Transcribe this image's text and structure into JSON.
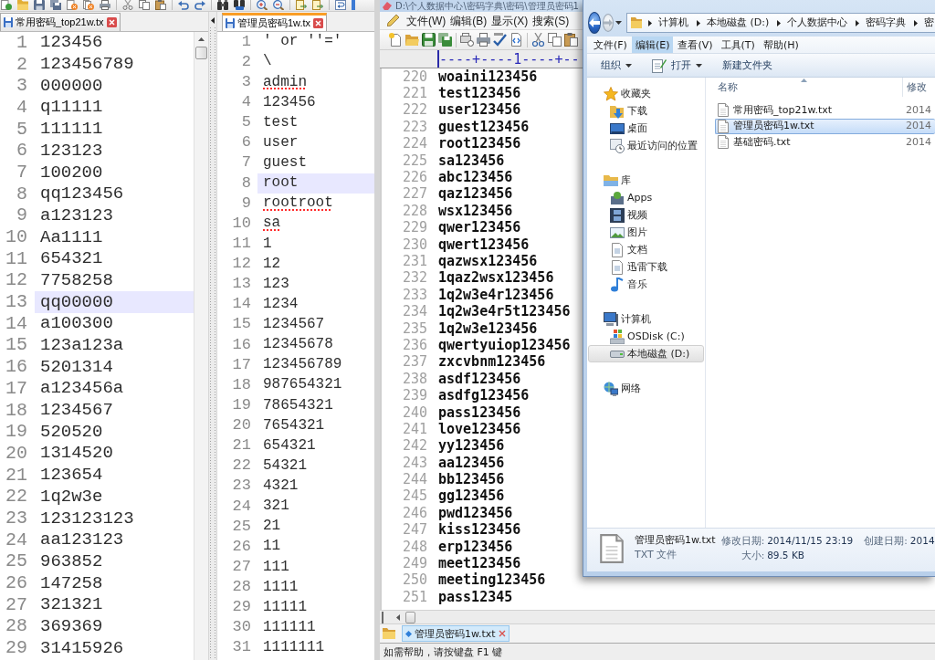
{
  "notepad": {
    "views": [
      {
        "tab": {
          "label": "常用密码_top21w.tx",
          "focused": false
        },
        "lines": [
          {
            "number": "1",
            "text": "123456",
            "current": false,
            "misspelled": false
          },
          {
            "number": "2",
            "text": "123456789",
            "current": false,
            "misspelled": false
          },
          {
            "number": "3",
            "text": "000000",
            "current": false,
            "misspelled": false
          },
          {
            "number": "4",
            "text": "q11111",
            "current": false,
            "misspelled": false
          },
          {
            "number": "5",
            "text": "111111",
            "current": false,
            "misspelled": false
          },
          {
            "number": "6",
            "text": "123123",
            "current": false,
            "misspelled": false
          },
          {
            "number": "7",
            "text": "100200",
            "current": false,
            "misspelled": false
          },
          {
            "number": "8",
            "text": "qq123456",
            "current": false,
            "misspelled": false
          },
          {
            "number": "9",
            "text": "a123123",
            "current": false,
            "misspelled": false
          },
          {
            "number": "10",
            "text": "Aa1111",
            "current": false,
            "misspelled": false
          },
          {
            "number": "11",
            "text": "654321",
            "current": false,
            "misspelled": false
          },
          {
            "number": "12",
            "text": "7758258",
            "current": false,
            "misspelled": false
          },
          {
            "number": "13",
            "text": "qq00000",
            "current": true,
            "misspelled": false
          },
          {
            "number": "14",
            "text": "a100300",
            "current": false,
            "misspelled": false
          },
          {
            "number": "15",
            "text": "123a123a",
            "current": false,
            "misspelled": false
          },
          {
            "number": "16",
            "text": "5201314",
            "current": false,
            "misspelled": false
          },
          {
            "number": "17",
            "text": "a123456a",
            "current": false,
            "misspelled": false
          },
          {
            "number": "18",
            "text": "1234567",
            "current": false,
            "misspelled": false
          },
          {
            "number": "19",
            "text": "520520",
            "current": false,
            "misspelled": false
          },
          {
            "number": "20",
            "text": "1314520",
            "current": false,
            "misspelled": false
          },
          {
            "number": "21",
            "text": "123654",
            "current": false,
            "misspelled": false
          },
          {
            "number": "22",
            "text": "1q2w3e",
            "current": false,
            "misspelled": false
          },
          {
            "number": "23",
            "text": "123123123",
            "current": false,
            "misspelled": false
          },
          {
            "number": "24",
            "text": "aa123123",
            "current": false,
            "misspelled": false
          },
          {
            "number": "25",
            "text": "963852",
            "current": false,
            "misspelled": false
          },
          {
            "number": "26",
            "text": "147258",
            "current": false,
            "misspelled": false
          },
          {
            "number": "27",
            "text": "321321",
            "current": false,
            "misspelled": false
          },
          {
            "number": "28",
            "text": "369369",
            "current": false,
            "misspelled": false
          },
          {
            "number": "29",
            "text": "31415926",
            "current": false,
            "misspelled": false
          }
        ]
      },
      {
        "tab": {
          "label": "管理员密码1w.tx",
          "focused": true
        },
        "lines": [
          {
            "number": "1",
            "text": "' or ''='",
            "current": false,
            "misspelled": false
          },
          {
            "number": "2",
            "text": "\\",
            "current": false,
            "misspelled": false
          },
          {
            "number": "3",
            "text": "admin",
            "current": false,
            "misspelled": true
          },
          {
            "number": "4",
            "text": "123456",
            "current": false,
            "misspelled": false
          },
          {
            "number": "5",
            "text": "test",
            "current": false,
            "misspelled": false
          },
          {
            "number": "6",
            "text": "user",
            "current": false,
            "misspelled": false
          },
          {
            "number": "7",
            "text": "guest",
            "current": false,
            "misspelled": false
          },
          {
            "number": "8",
            "text": "root",
            "current": true,
            "misspelled": false
          },
          {
            "number": "9",
            "text": "rootroot",
            "current": false,
            "misspelled": true
          },
          {
            "number": "10",
            "text": "sa",
            "current": false,
            "misspelled": true
          },
          {
            "number": "11",
            "text": "1",
            "current": false,
            "misspelled": false
          },
          {
            "number": "12",
            "text": "12",
            "current": false,
            "misspelled": false
          },
          {
            "number": "13",
            "text": "123",
            "current": false,
            "misspelled": false
          },
          {
            "number": "14",
            "text": "1234",
            "current": false,
            "misspelled": false
          },
          {
            "number": "15",
            "text": "1234567",
            "current": false,
            "misspelled": false
          },
          {
            "number": "16",
            "text": "12345678",
            "current": false,
            "misspelled": false
          },
          {
            "number": "17",
            "text": "123456789",
            "current": false,
            "misspelled": false
          },
          {
            "number": "18",
            "text": "987654321",
            "current": false,
            "misspelled": false
          },
          {
            "number": "19",
            "text": "78654321",
            "current": false,
            "misspelled": false
          },
          {
            "number": "20",
            "text": "7654321",
            "current": false,
            "misspelled": false
          },
          {
            "number": "21",
            "text": "654321",
            "current": false,
            "misspelled": false
          },
          {
            "number": "22",
            "text": "54321",
            "current": false,
            "misspelled": false
          },
          {
            "number": "23",
            "text": "4321",
            "current": false,
            "misspelled": false
          },
          {
            "number": "24",
            "text": "321",
            "current": false,
            "misspelled": false
          },
          {
            "number": "25",
            "text": "21",
            "current": false,
            "misspelled": false
          },
          {
            "number": "26",
            "text": "11",
            "current": false,
            "misspelled": false
          },
          {
            "number": "27",
            "text": "111",
            "current": false,
            "misspelled": false
          },
          {
            "number": "28",
            "text": "1111",
            "current": false,
            "misspelled": false
          },
          {
            "number": "29",
            "text": "11111",
            "current": false,
            "misspelled": false
          },
          {
            "number": "30",
            "text": "111111",
            "current": false,
            "misspelled": false
          },
          {
            "number": "31",
            "text": "1111111",
            "current": false,
            "misspelled": false
          }
        ]
      }
    ]
  },
  "editor": {
    "title": "D:\\个人数据中心\\密码字典\\密码\\管理员密码1",
    "menu": [
      "文件(W)",
      "编辑(B)",
      "显示(X)",
      "搜索(S)"
    ],
    "ruler": "----+----1----+--",
    "lines": [
      {
        "number": "220",
        "text": "woaini123456"
      },
      {
        "number": "221",
        "text": "test123456"
      },
      {
        "number": "222",
        "text": "user123456"
      },
      {
        "number": "223",
        "text": "guest123456"
      },
      {
        "number": "224",
        "text": "root123456"
      },
      {
        "number": "225",
        "text": "sa123456"
      },
      {
        "number": "226",
        "text": "abc123456"
      },
      {
        "number": "227",
        "text": "qaz123456"
      },
      {
        "number": "228",
        "text": "wsx123456"
      },
      {
        "number": "229",
        "text": "qwer123456"
      },
      {
        "number": "230",
        "text": "qwert123456"
      },
      {
        "number": "231",
        "text": "qazwsx123456"
      },
      {
        "number": "232",
        "text": "1qaz2wsx123456"
      },
      {
        "number": "233",
        "text": "1q2w3e4r123456"
      },
      {
        "number": "234",
        "text": "1q2w3e4r5t123456"
      },
      {
        "number": "235",
        "text": "1q2w3e123456"
      },
      {
        "number": "236",
        "text": "qwertyuiop123456"
      },
      {
        "number": "237",
        "text": "zxcvbnm123456"
      },
      {
        "number": "238",
        "text": "asdf123456"
      },
      {
        "number": "239",
        "text": "asdfg123456"
      },
      {
        "number": "240",
        "text": "pass123456"
      },
      {
        "number": "241",
        "text": "love123456"
      },
      {
        "number": "242",
        "text": "yy123456"
      },
      {
        "number": "243",
        "text": "aa123456"
      },
      {
        "number": "244",
        "text": "bb123456"
      },
      {
        "number": "245",
        "text": "gg123456"
      },
      {
        "number": "246",
        "text": "pwd123456"
      },
      {
        "number": "247",
        "text": "kiss123456"
      },
      {
        "number": "248",
        "text": "erp123456"
      },
      {
        "number": "249",
        "text": "meet123456"
      },
      {
        "number": "250",
        "text": "meeting123456"
      },
      {
        "number": "251",
        "text": "pass12345"
      }
    ],
    "file_tabs": [
      {
        "label": "管理员密码1w.txt",
        "selected": true
      }
    ],
    "status_bar": "如需帮助，请按键盘 F1 键"
  },
  "explorer": {
    "breadcrumbs": [
      "计算机",
      "本地磁盘 (D:)",
      "个人数据中心",
      "密码字典",
      "密"
    ],
    "menu": [
      {
        "label": "文件(F)",
        "selected": false
      },
      {
        "label": "编辑(E)",
        "selected": true
      },
      {
        "label": "查看(V)",
        "selected": false
      },
      {
        "label": "工具(T)",
        "selected": false
      },
      {
        "label": "帮助(H)",
        "selected": false
      }
    ],
    "commands": [
      {
        "label": "组织",
        "kind": "menu"
      },
      {
        "label": "打开",
        "kind": "icon-menu"
      },
      {
        "label": "新建文件夹",
        "kind": "plain"
      }
    ],
    "nav": [
      {
        "label": "收藏夹",
        "selected": false,
        "children": [
          {
            "label": "下载",
            "selected": false
          },
          {
            "label": "桌面",
            "selected": false
          },
          {
            "label": "最近访问的位置",
            "selected": false
          }
        ]
      },
      {
        "label": "库",
        "selected": false,
        "children": [
          {
            "label": "Apps",
            "selected": false
          },
          {
            "label": "视频",
            "selected": false
          },
          {
            "label": "图片",
            "selected": false
          },
          {
            "label": "文档",
            "selected": false
          },
          {
            "label": "迅雷下载",
            "selected": false
          },
          {
            "label": "音乐",
            "selected": false
          }
        ]
      },
      {
        "label": "计算机",
        "selected": false,
        "children": [
          {
            "label": "OSDisk (C:)",
            "selected": false
          },
          {
            "label": "本地磁盘 (D:)",
            "selected": true
          }
        ]
      },
      {
        "label": "网络",
        "selected": false
      }
    ],
    "columns": [
      {
        "label": "名称",
        "sorted": true
      },
      {
        "label": "修改",
        "sorted": false
      }
    ],
    "files": [
      {
        "name": "常用密码_top21w.txt",
        "modified": "2014",
        "selected": false
      },
      {
        "name": "管理员密码1w.txt",
        "modified": "2014",
        "selected": true
      },
      {
        "name": "基础密码.txt",
        "modified": "2014",
        "selected": false
      }
    ],
    "details": {
      "name": "管理员密码1w.txt",
      "type": "TXT 文件",
      "field_columns": [
        [
          {
            "label": "修改日期:",
            "value": "2014/11/15 23:19"
          },
          {
            "label": "大小:",
            "value": "89.5 KB"
          }
        ],
        [
          {
            "label": "创建日期:",
            "value": "2014"
          }
        ]
      ]
    }
  }
}
